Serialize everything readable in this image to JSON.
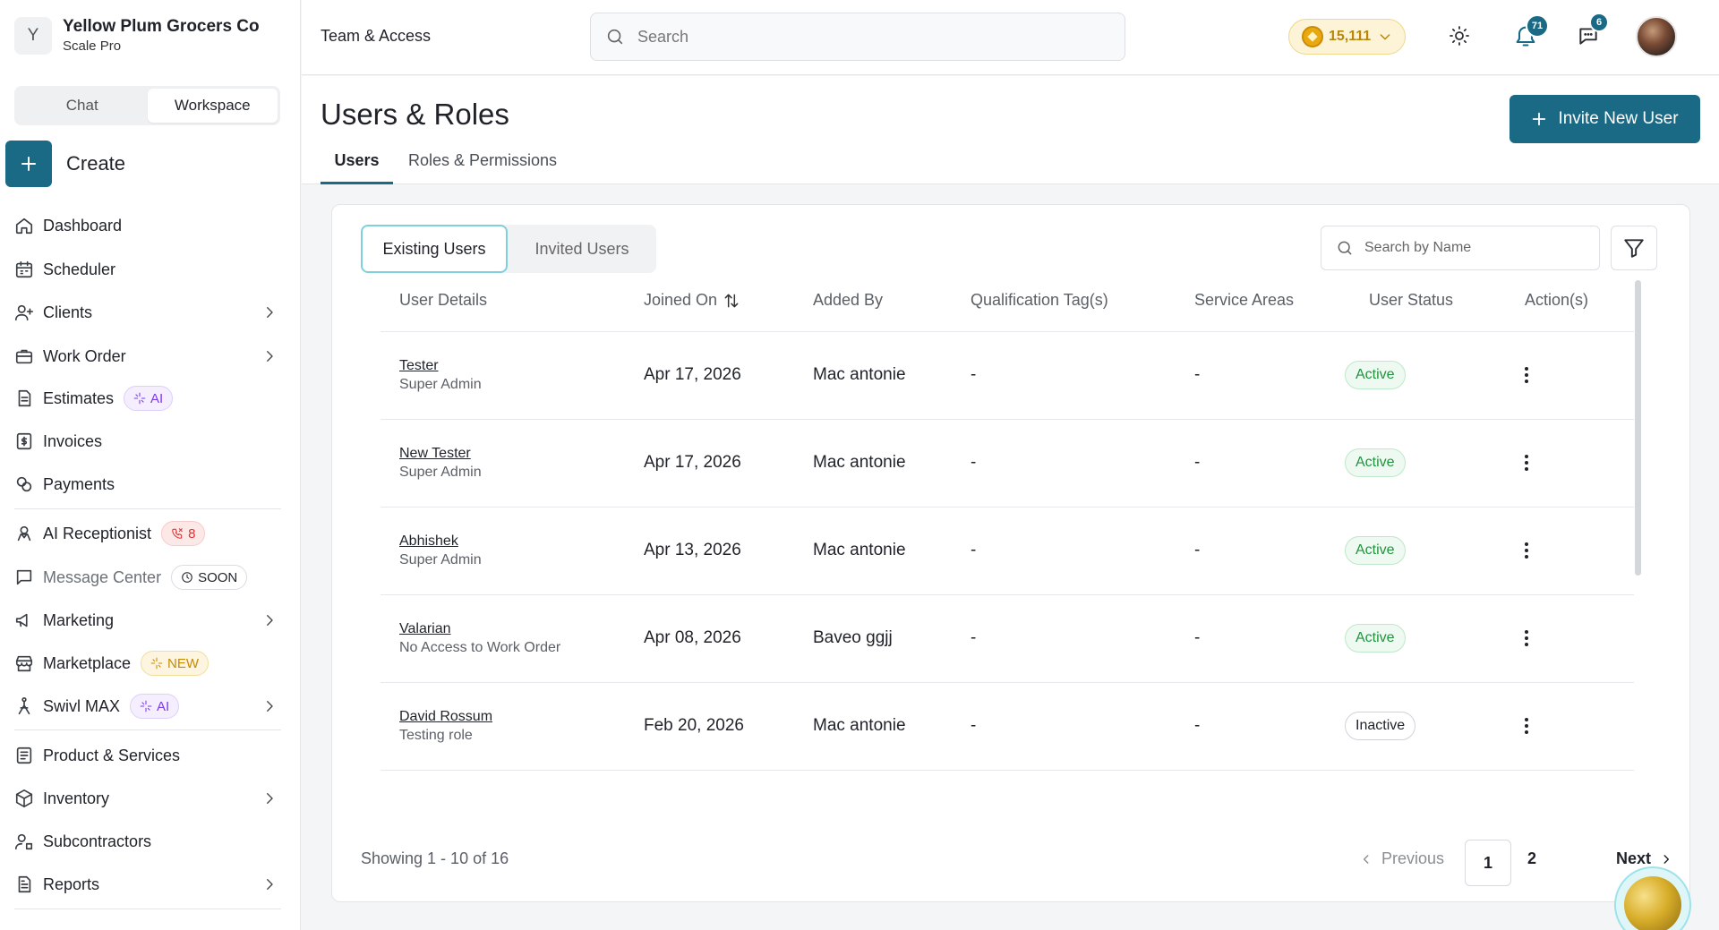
{
  "org": {
    "initial": "Y",
    "name": "Yellow Plum Grocers Co",
    "plan": "Scale Pro"
  },
  "mode_switch": {
    "chat": "Chat",
    "workspace": "Workspace",
    "selected": "Workspace"
  },
  "create_label": "Create",
  "sidebar": {
    "items": [
      {
        "label": "Dashboard",
        "icon": "home-icon"
      },
      {
        "label": "Scheduler",
        "icon": "calendar-icon"
      },
      {
        "label": "Clients",
        "icon": "user-plus-icon",
        "expandable": true
      },
      {
        "label": "Work Order",
        "icon": "briefcase-icon",
        "expandable": true
      },
      {
        "label": "Estimates",
        "icon": "document-icon",
        "badge": "AI"
      },
      {
        "label": "Invoices",
        "icon": "invoice-icon"
      },
      {
        "label": "Payments",
        "icon": "coins-icon"
      },
      {
        "label": "AI Receptionist",
        "icon": "receptionist-icon",
        "badge": "8"
      },
      {
        "label": "Message Center",
        "icon": "message-icon",
        "badge": "SOON"
      },
      {
        "label": "Marketing",
        "icon": "megaphone-icon",
        "expandable": true
      },
      {
        "label": "Marketplace",
        "icon": "store-icon",
        "badge": "NEW"
      },
      {
        "label": "Swivl MAX",
        "icon": "figure-icon",
        "badge": "AI",
        "expandable": true
      },
      {
        "label": "Product & Services",
        "icon": "catalog-icon"
      },
      {
        "label": "Inventory",
        "icon": "box-icon",
        "expandable": true
      },
      {
        "label": "Subcontractors",
        "icon": "users-icon"
      },
      {
        "label": "Reports",
        "icon": "report-icon",
        "expandable": true
      }
    ]
  },
  "topbar": {
    "breadcrumb": "Team & Access",
    "search_placeholder": "Search",
    "credits": "15,111",
    "notifications_count": "71",
    "messages_count": "6"
  },
  "page": {
    "title": "Users & Roles",
    "invite_label": "Invite New User",
    "tabs": [
      "Users",
      "Roles & Permissions"
    ],
    "active_tab": "Users"
  },
  "users_panel": {
    "segments": [
      "Existing Users",
      "Invited Users"
    ],
    "active_segment": "Existing Users",
    "search_placeholder": "Search by Name",
    "columns": [
      "User Details",
      "Joined On",
      "Added By",
      "Qualification Tag(s)",
      "Service Areas",
      "User Status",
      "Action(s)"
    ],
    "rows": [
      {
        "name": "Tester",
        "role": "Super Admin",
        "joined": "Apr 17, 2026",
        "added_by": "Mac antonie",
        "tags": "-",
        "areas": "-",
        "status": "Active"
      },
      {
        "name": "New Tester",
        "role": "Super Admin",
        "joined": "Apr 17, 2026",
        "added_by": "Mac antonie",
        "tags": "-",
        "areas": "-",
        "status": "Active"
      },
      {
        "name": "Abhishek",
        "role": "Super Admin",
        "joined": "Apr 13, 2026",
        "added_by": "Mac antonie",
        "tags": "-",
        "areas": "-",
        "status": "Active"
      },
      {
        "name": "Valarian",
        "role": "No Access to Work Order",
        "joined": "Apr 08, 2026",
        "added_by": "Baveo ggjj",
        "tags": "-",
        "areas": "-",
        "status": "Active"
      },
      {
        "name": "David Rossum",
        "role": "Testing role",
        "joined": "Feb 20, 2026",
        "added_by": "Mac antonie",
        "tags": "-",
        "areas": "-",
        "status": "Inactive"
      }
    ],
    "pagination": {
      "showing": "Showing 1 - 10 of 16",
      "previous": "Previous",
      "pages": [
        "1",
        "2"
      ],
      "current": "1",
      "next": "Next"
    }
  },
  "colors": {
    "brand": "#1a6a86",
    "active_status": "#22933f",
    "ai_badge": "#7c3aed",
    "receptionist_badge": "#d93535",
    "new_badge": "#c68a07"
  }
}
